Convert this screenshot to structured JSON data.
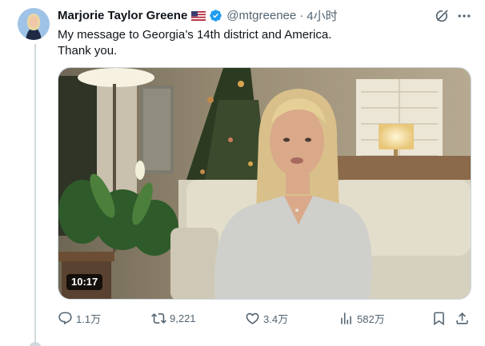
{
  "author": {
    "display_name": "Marjorie Taylor Greene",
    "handle": "@mtgreenee",
    "separator": "·",
    "time": "4小时"
  },
  "tweet": {
    "lines": [
      "My message to Georgia’s 14th district and America.",
      "Thank you."
    ]
  },
  "media": {
    "duration": "10:17"
  },
  "actions": {
    "replies": "1.1万",
    "retweets": "9,221",
    "likes": "3.4万",
    "views": "582万"
  },
  "colors": {
    "text": "#0f1419",
    "secondary": "#536471",
    "verified": "#1d9bf0",
    "border": "#cfd9de"
  },
  "icons": [
    "flag-us-icon",
    "verified-badge-icon",
    "grok-icon",
    "more-icon",
    "reply-icon",
    "retweet-icon",
    "like-icon",
    "views-icon",
    "bookmark-icon",
    "share-icon"
  ]
}
